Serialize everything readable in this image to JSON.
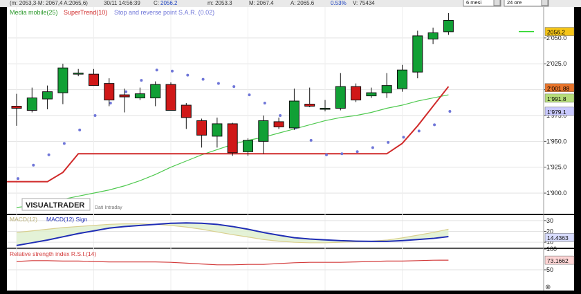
{
  "header": {
    "date_text": "(m: 2053,3-M: 2067,4 A:2065,6)",
    "time_text": "30/11 14:56:39",
    "last_label": "C:",
    "last_value": "2056.2",
    "min_text": "m: 2053.3",
    "max_text": "M: 2067.4",
    "open_text": "A: 2065.6",
    "pct_text": "0.53%",
    "volume_text": "V: 75434",
    "period_select": "6 mesi",
    "interval_select": "24 ore"
  },
  "legend": {
    "ma": "Media mobile(25)",
    "supertrend": "SuperTrend(10)",
    "sar": "Stop and reverse point S.A.R. (0.02)"
  },
  "watermark": {
    "brand": "VISUALTRADER",
    "subtitle": "Dati Intraday"
  },
  "colors": {
    "up": "#11a035",
    "down": "#d01818",
    "ma": "#4fc94f",
    "supertrend": "#d02a2a",
    "sar": "#6f76d8",
    "macd": "#1f2db5",
    "signal": "#d9cf8e",
    "rsi": "#d33b3b"
  },
  "chart_data": [
    {
      "type": "candlestick",
      "ylim": [
        1880,
        2080
      ],
      "yticks": [
        "2'050.0",
        "2'025.0",
        "2'000.0",
        "1'975.0",
        "1'950.0",
        "1'925.0",
        "1'900.0"
      ],
      "ytick_values": [
        2050,
        2025,
        2000,
        1975,
        1950,
        1925,
        1900
      ],
      "ohlc": [
        {
          "o": 1984,
          "h": 1996,
          "l": 1965,
          "c": 1982
        },
        {
          "o": 1980,
          "h": 2002,
          "l": 1978,
          "c": 1992
        },
        {
          "o": 1991,
          "h": 2004,
          "l": 1981,
          "c": 1998
        },
        {
          "o": 1997,
          "h": 2025,
          "l": 1986,
          "c": 2021
        },
        {
          "o": 2016,
          "h": 2020,
          "l": 2013,
          "c": 2016
        },
        {
          "o": 2015,
          "h": 2020,
          "l": 2005,
          "c": 2004
        },
        {
          "o": 2006,
          "h": 2011,
          "l": 1984,
          "c": 1990
        },
        {
          "o": 1995,
          "h": 2001,
          "l": 1978,
          "c": 1993
        },
        {
          "o": 1992,
          "h": 2002,
          "l": 1990,
          "c": 1996
        },
        {
          "o": 1992,
          "h": 2008,
          "l": 1984,
          "c": 2005
        },
        {
          "o": 2005,
          "h": 2007,
          "l": 1984,
          "c": 1980
        },
        {
          "o": 1985,
          "h": 1987,
          "l": 1962,
          "c": 1973
        },
        {
          "o": 1970,
          "h": 1972,
          "l": 1944,
          "c": 1956
        },
        {
          "o": 1955,
          "h": 1973,
          "l": 1944,
          "c": 1967
        },
        {
          "o": 1967,
          "h": 1968,
          "l": 1936,
          "c": 1939
        },
        {
          "o": 1940,
          "h": 1953,
          "l": 1936,
          "c": 1951
        },
        {
          "o": 1950,
          "h": 1975,
          "l": 1938,
          "c": 1970
        },
        {
          "o": 1969,
          "h": 1973,
          "l": 1962,
          "c": 1964
        },
        {
          "o": 1963,
          "h": 2001,
          "l": 1961,
          "c": 1989
        },
        {
          "o": 1986,
          "h": 2002,
          "l": 1983,
          "c": 1984
        },
        {
          "o": 1981,
          "h": 1990,
          "l": 1979,
          "c": 1982
        },
        {
          "o": 1982,
          "h": 2016,
          "l": 1980,
          "c": 2003
        },
        {
          "o": 2003,
          "h": 2006,
          "l": 1988,
          "c": 1990
        },
        {
          "o": 1994,
          "h": 2002,
          "l": 1992,
          "c": 1997
        },
        {
          "o": 1997,
          "h": 2016,
          "l": 1992,
          "c": 2004
        },
        {
          "o": 2001,
          "h": 2024,
          "l": 1998,
          "c": 2019
        },
        {
          "o": 2017,
          "h": 2057,
          "l": 2011,
          "c": 2052
        },
        {
          "o": 2049,
          "h": 2060,
          "l": 2044,
          "c": 2055
        },
        {
          "o": 2056,
          "h": 2074,
          "l": 2053,
          "c": 2067
        }
      ],
      "ma": [
        1886,
        1888,
        1891,
        1894,
        1897,
        1900,
        1903,
        1907,
        1912,
        1918,
        1925,
        1931,
        1937,
        1942,
        1947,
        1951,
        1954,
        1958,
        1962,
        1966,
        1970,
        1973,
        1975,
        1978,
        1982,
        1985,
        1989,
        1992,
        1995
      ],
      "supertrend": [
        1911,
        1911,
        1911,
        1920,
        1938,
        1938,
        1938,
        1938,
        1938,
        1938,
        1938,
        1938,
        1938,
        1938,
        1938,
        1938,
        1938,
        1938,
        1938,
        1938,
        1938,
        1938,
        1938,
        1938,
        1938,
        1948,
        1965,
        1984,
        2003
      ],
      "sar": [
        1914,
        1927,
        1937,
        1948,
        1961,
        1975,
        1987,
        1998,
        2009,
        2019,
        2018,
        2014,
        2010,
        2006,
        2003,
        1995,
        1987,
        1975,
        1963,
        1951,
        1937,
        1938,
        1940,
        1944,
        1949,
        1954,
        1960,
        1966,
        1979
      ],
      "right_labels": [
        {
          "text": "2056.2",
          "value": 2056.2,
          "bg": "#f5c518",
          "fg": "#000"
        },
        {
          "text": "2'001.88",
          "value": 2001.88,
          "bg": "#e8742a",
          "fg": "#000"
        },
        {
          "text": "1'991.8",
          "value": 1991.8,
          "bg": "#b6dd7a",
          "fg": "#000"
        },
        {
          "text": "1'979.1",
          "value": 1979.1,
          "bg": "#c9c9ff",
          "fg": "#000"
        }
      ]
    },
    {
      "type": "line",
      "title": "MACD(12) / MACD(12) Sign",
      "series_labels": [
        "MACD(12)",
        "MACD(12) Sign"
      ],
      "ylim": [
        5,
        35
      ],
      "yticks": [
        "30",
        "20",
        "10"
      ],
      "ytick_values": [
        30,
        20,
        10
      ],
      "macd": [
        7,
        9.5,
        12,
        15,
        18,
        20.5,
        23,
        24.5,
        25.5,
        26.5,
        27.5,
        27.8,
        27.5,
        26.5,
        24.5,
        22,
        19,
        16.5,
        14.2,
        13,
        12.2,
        11.5,
        11,
        10.8,
        10.8,
        11.5,
        12.5,
        13.5,
        15.2
      ],
      "signal": [
        19,
        20.5,
        22,
        23.5,
        24.5,
        25.5,
        26.5,
        27,
        27,
        26.5,
        25.5,
        24,
        22,
        19.5,
        17,
        14.8,
        12.5,
        11,
        10,
        9.5,
        9.5,
        10,
        10.5,
        11,
        12,
        14,
        16.5,
        19,
        22
      ],
      "last_label": {
        "text": "14.4363",
        "value": 14.4363
      }
    },
    {
      "type": "line",
      "title": "Relative strength index R.S.I.(14)",
      "ylim": [
        0,
        100
      ],
      "yticks": [
        "100",
        "50"
      ],
      "ytick_values": [
        100,
        50
      ],
      "values": [
        70,
        72,
        72,
        71,
        71,
        70,
        69,
        69,
        69,
        69,
        68,
        66,
        64,
        62,
        62,
        63,
        63,
        65,
        67,
        68,
        68,
        68,
        69,
        70,
        71,
        71,
        72,
        73,
        73.17
      ],
      "last_label": {
        "text": "73.1662",
        "value": 73.1662
      }
    }
  ]
}
